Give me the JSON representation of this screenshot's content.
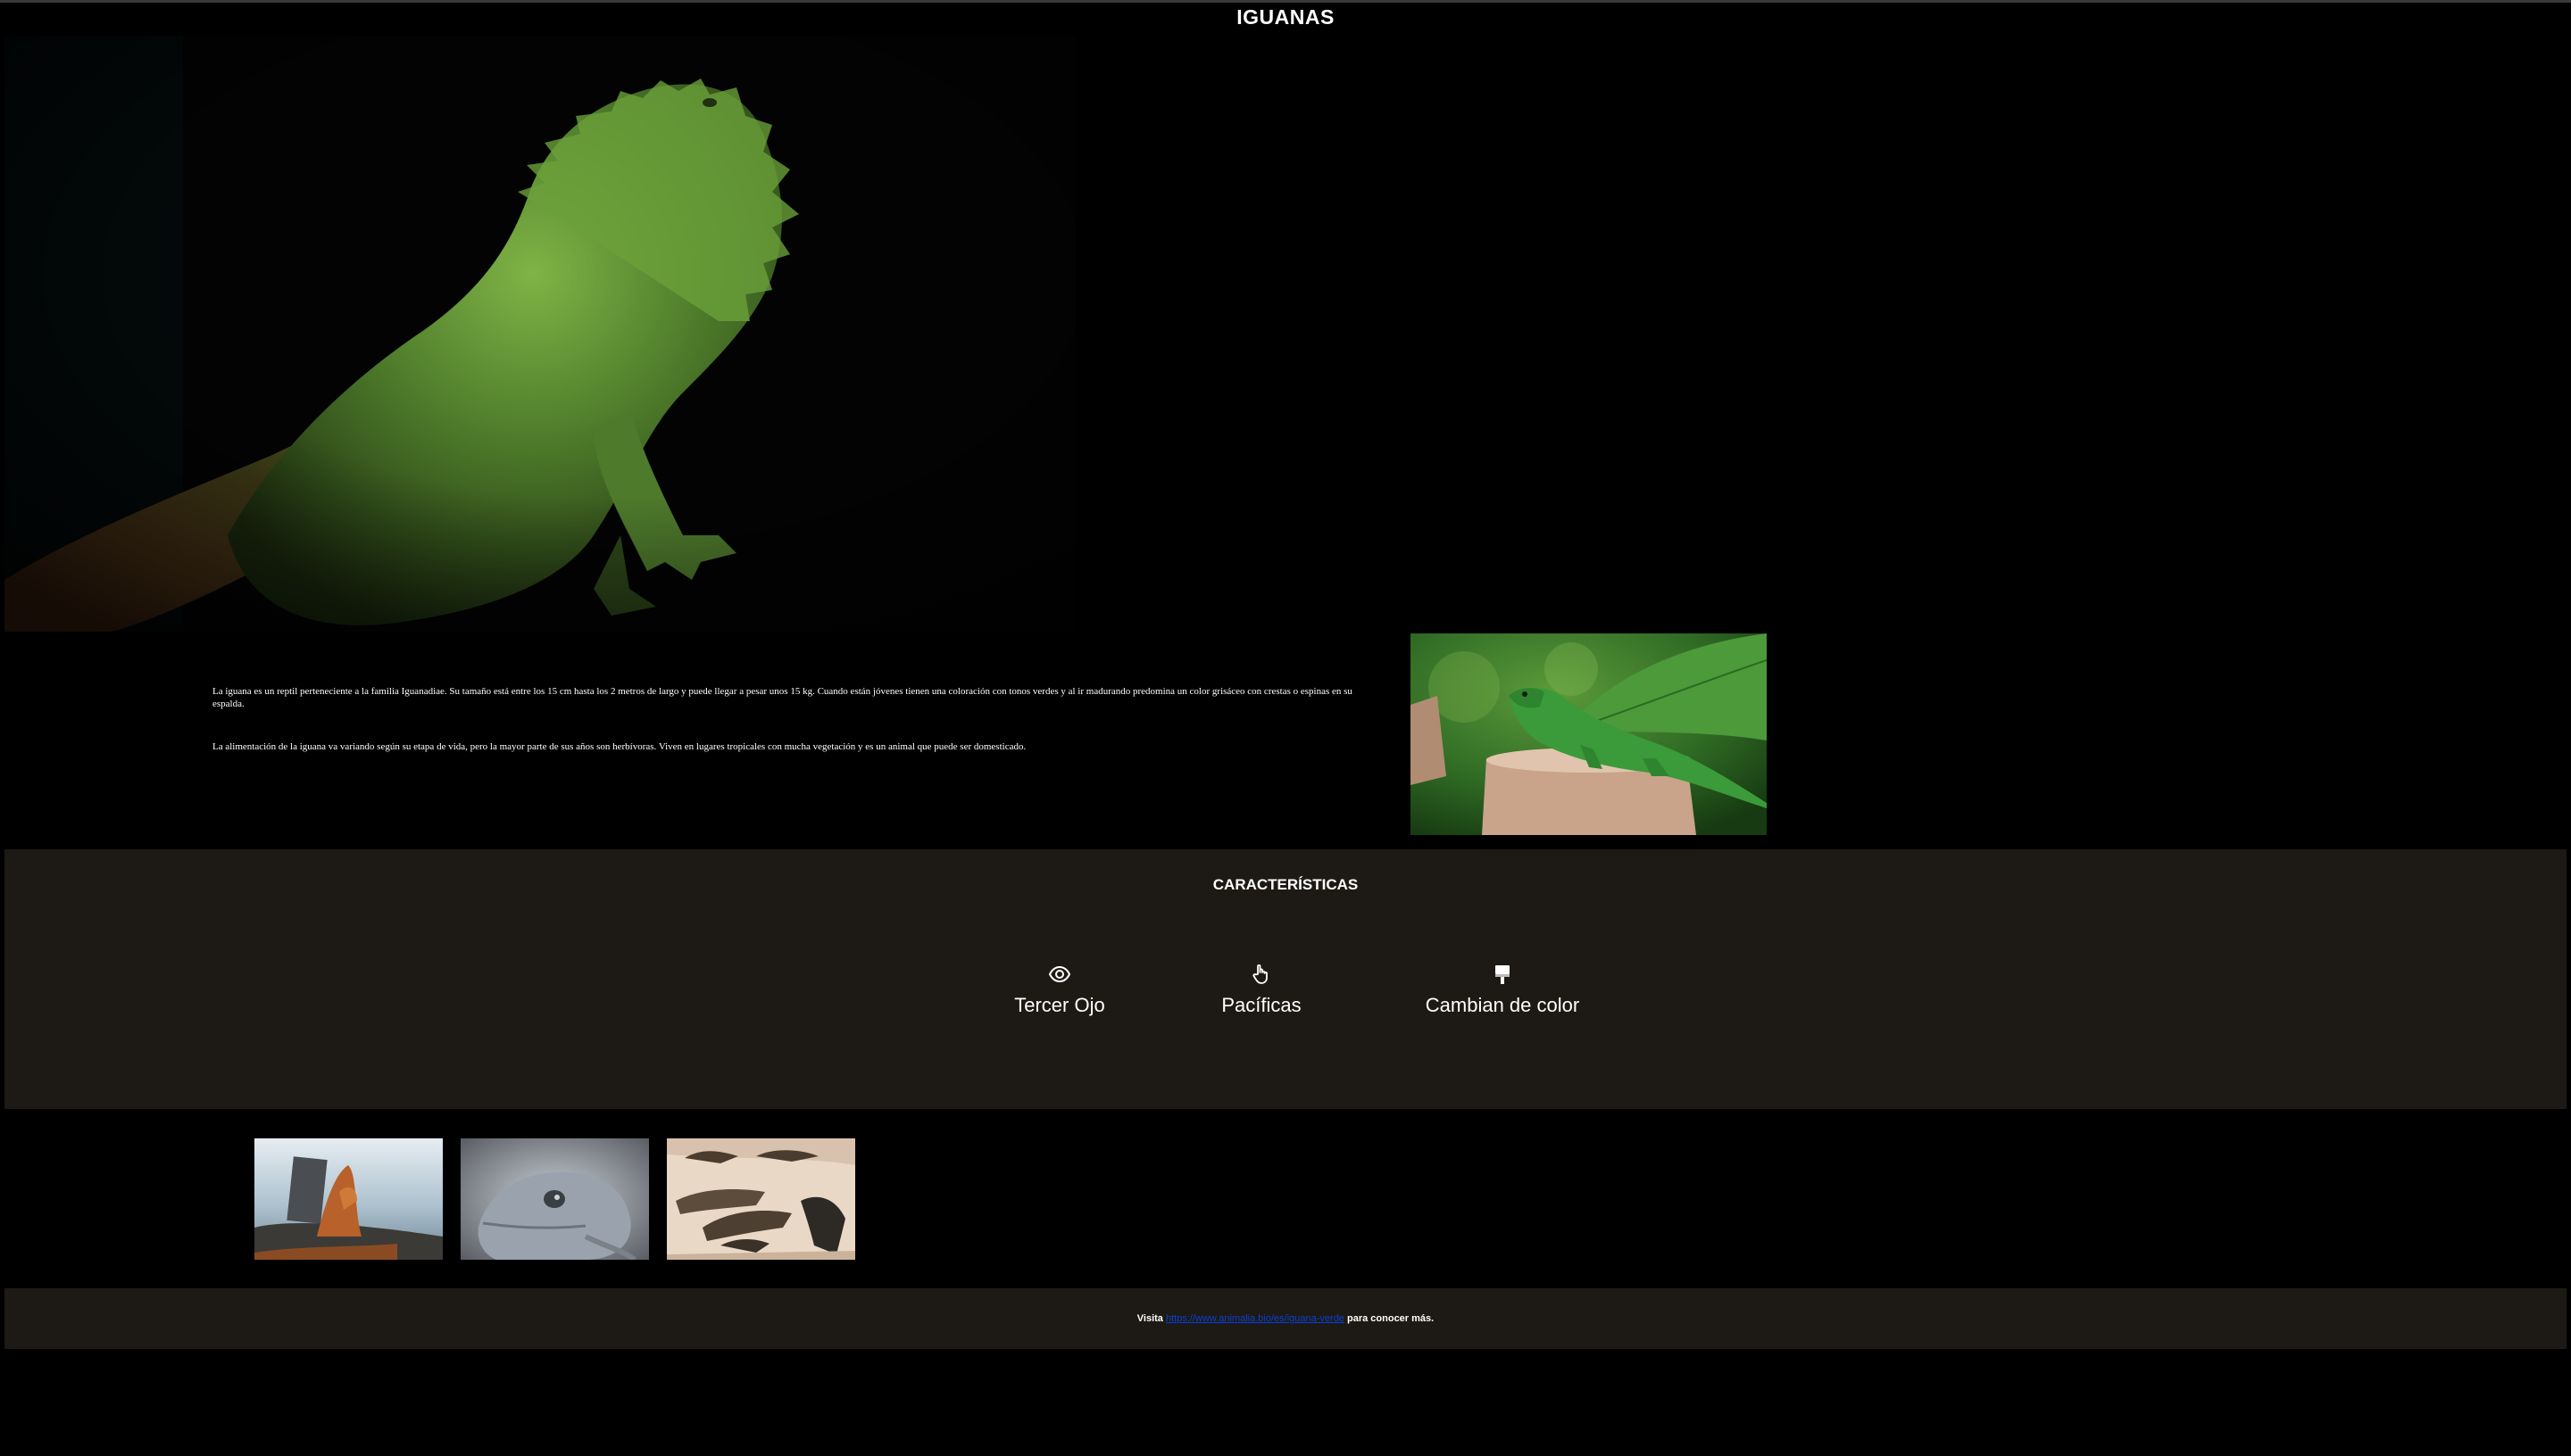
{
  "header": {
    "title": "IGUANAS"
  },
  "intro": {
    "paragraphs": [
      "La iguana es un reptil perteneciente a la familia Iguanadiae. Su tamaño está entre los 15 cm hasta los 2 metros de largo y puede llegar a pesar unos 15 kg. Cuando están jóvenes tienen una coloración con tonos verdes y al ir madurando predomina un color grisáceo con crestas o espinas en su espalda.",
      "La alimentación de la iguana va variando según su etapa de vida, pero la mayor parte de sus años son herbívoras. Viven en lugares tropicales con mucha vegetación y es un animal que puede ser domesticado."
    ]
  },
  "features": {
    "title": "CARACTERÍSTICAS",
    "items": [
      {
        "icon": "eye-icon",
        "label": "Tercer Ojo"
      },
      {
        "icon": "hand-pointer-icon",
        "label": "Pacíficas"
      },
      {
        "icon": "paint-brush-icon",
        "label": "Cambian de color"
      }
    ]
  },
  "footer": {
    "prefix": "Visita",
    "link_text": "https://www.animalia.bio/es/iguana-verde",
    "suffix": "para conocer más."
  },
  "colors": {
    "background": "#000000",
    "section_background": "#1d1a15",
    "link": "#0b3fd8"
  }
}
